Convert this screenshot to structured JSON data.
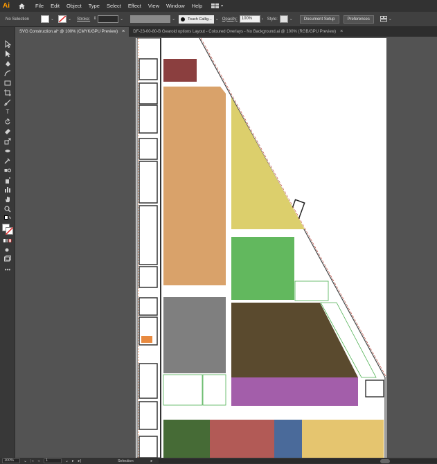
{
  "app": {
    "logo": "Ai"
  },
  "menu": [
    "File",
    "Edit",
    "Object",
    "Type",
    "Select",
    "Effect",
    "View",
    "Window",
    "Help"
  ],
  "options": {
    "selection_label": "No Selection",
    "stroke_label": "Stroke:",
    "brush_name": "Touch Callig...",
    "opacity_label": "Opacity:",
    "opacity_value": "100%",
    "style_label": "Style:",
    "document_setup": "Document Setup",
    "preferences": "Preferences"
  },
  "tabs": [
    {
      "label": "SVG Construction.ai* @ 100% (CMYK/GPU Preview)",
      "active": true
    },
    {
      "label": "DF-23-00-80-B Gearoid options Layout - Coloured Overlays - No Background.ai @ 100% (RGB/GPU Preview)",
      "active": false
    }
  ],
  "status": {
    "zoom": "100%",
    "artboard": "1",
    "mode": "Selection"
  },
  "plan_colors": {
    "maroon": "#8b3f3f",
    "tan": "#d9a26a",
    "yellow": "#dccf6c",
    "green": "#62b85e",
    "gray": "#7f7f7f",
    "brown": "#5a4a2e",
    "purple": "#a35eaa",
    "dark_green": "#466b36",
    "red": "#b25a56",
    "blue": "#4a6a9a",
    "sand": "#e5c56f"
  },
  "tools": [
    "selection-tool",
    "direct-selection-tool",
    "pen-tool",
    "curvature-tool",
    "rectangle-tool",
    "artboard-tool",
    "paintbrush-tool",
    "pencil-tool",
    "type-tool",
    "rotate-tool",
    "eraser-tool",
    "scale-tool",
    "width-tool",
    "shape-builder-tool",
    "eyedropper-tool",
    "blend-tool",
    "symbol-sprayer-tool",
    "column-graph-tool",
    "hand-tool",
    "zoom-tool"
  ]
}
